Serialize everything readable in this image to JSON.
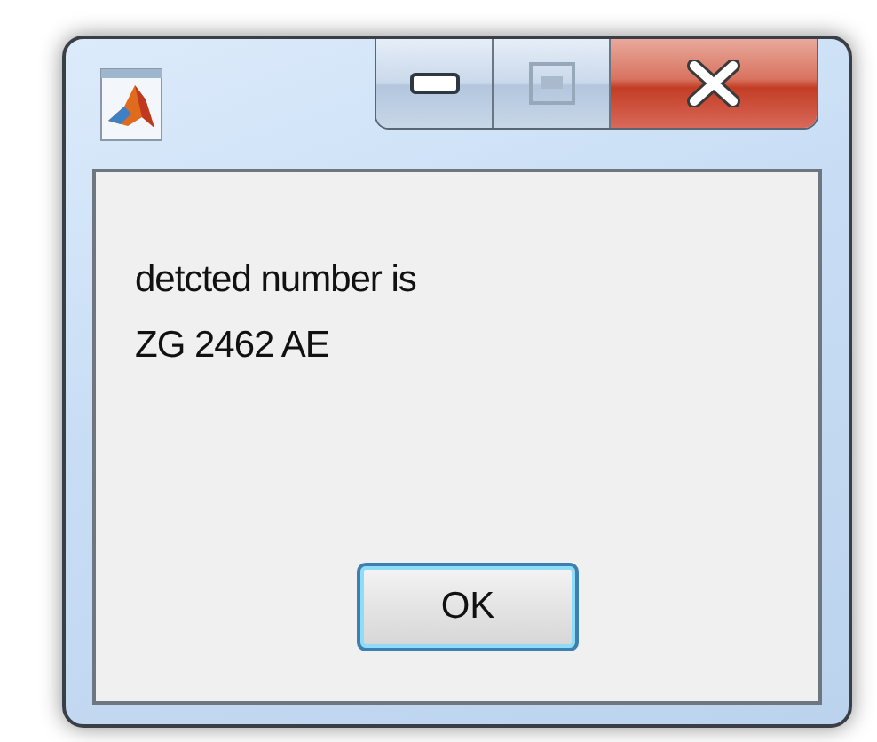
{
  "message": {
    "lines": [
      "detcted number is",
      "ZG 2462 AE"
    ]
  },
  "buttons": [
    {
      "label": "OK",
      "default": true
    }
  ]
}
